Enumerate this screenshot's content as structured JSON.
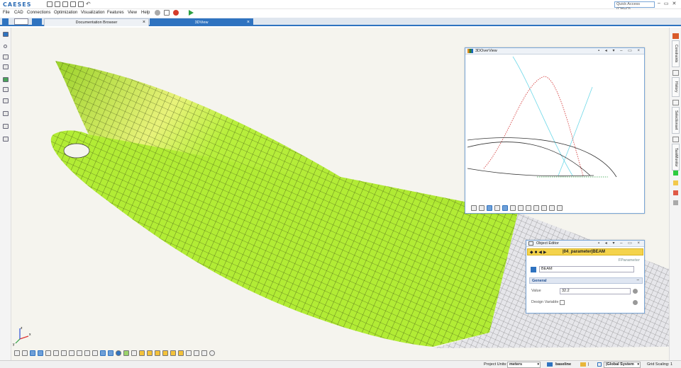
{
  "app": {
    "logo_text": "CAESES"
  },
  "titlebar": {
    "quick_access_placeholder": "Quick Access (Ctrl+Q)",
    "win_min": "–",
    "win_restore": "▭",
    "win_close": "✕"
  },
  "menu": [
    "File",
    "CAD",
    "Connections",
    "Optimization",
    "Visualization",
    "Features",
    "View",
    "Help"
  ],
  "tabs": [
    {
      "label": "Documentation Browser",
      "close": "×"
    },
    {
      "label": "3DView",
      "close": "×"
    }
  ],
  "right_tabs": [
    "Constraints",
    "History",
    "Selectionset",
    "TaskMonitor"
  ],
  "right_swatches": [
    "#2ecc40",
    "#f2c94c",
    "#e05a47",
    "#aaaaaa"
  ],
  "overview": {
    "title": "3DOverView",
    "controls": "▪ ◂ ▾ – ▭ ×"
  },
  "object_editor": {
    "title": "Object Editor",
    "controls": "▪ ◂ ▾ – ▭ ×",
    "path": "|04_parameter|BEAM",
    "type_label": "FParameter",
    "name": "BEAM",
    "section": "General",
    "section_toggle": "–",
    "value_label": "Value",
    "value": "32.2",
    "design_variable_label": "Design Variable",
    "design_variable_checked": false
  },
  "status": {
    "project_units_label": "Project Units:",
    "project_units": "meters",
    "baseline": "baseline",
    "separator": "|",
    "coord_system": "|Global System",
    "grid_scaling": "Grid Scaling: 1"
  },
  "axis": {
    "x": "x",
    "y": "y",
    "z": "z"
  },
  "colors": {
    "accent": "#2f73c0",
    "hull_green": "#b6f03c",
    "hull_yellow": "#f4f08a",
    "mesh": "#3a4a10"
  }
}
